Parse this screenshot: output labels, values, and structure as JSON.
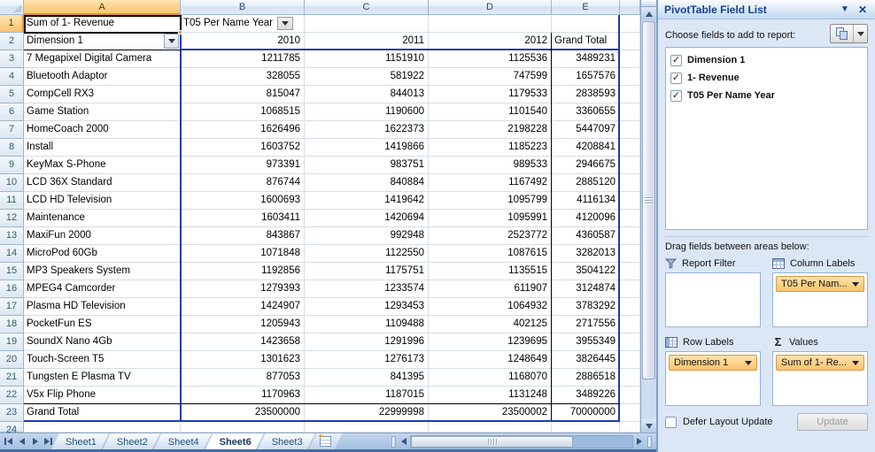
{
  "grid": {
    "column_headers": [
      "A",
      "B",
      "C",
      "D",
      "E"
    ],
    "selected_column": "A",
    "selected_row": 1,
    "cells": {
      "a1": "Sum of 1- Revenue",
      "b1": "T05 Per Name Year",
      "a2": "Dimension 1"
    },
    "year_headers": [
      "2010",
      "2011",
      "2012",
      "Grand Total"
    ],
    "products": [
      {
        "name": "7 Megapixel Digital Camera",
        "values": [
          1211785,
          1151910,
          1125536,
          3489231
        ]
      },
      {
        "name": "Bluetooth Adaptor",
        "values": [
          328055,
          581922,
          747599,
          1657576
        ]
      },
      {
        "name": "CompCell RX3",
        "values": [
          815047,
          844013,
          1179533,
          2838593
        ]
      },
      {
        "name": "Game Station",
        "values": [
          1068515,
          1190600,
          1101540,
          3360655
        ]
      },
      {
        "name": "HomeCoach 2000",
        "values": [
          1626496,
          1622373,
          2198228,
          5447097
        ]
      },
      {
        "name": "Install",
        "values": [
          1603752,
          1419866,
          1185223,
          4208841
        ]
      },
      {
        "name": "KeyMax S-Phone",
        "values": [
          973391,
          983751,
          989533,
          2946675
        ]
      },
      {
        "name": "LCD 36X Standard",
        "values": [
          876744,
          840884,
          1167492,
          2885120
        ]
      },
      {
        "name": "LCD HD Television",
        "values": [
          1600693,
          1419642,
          1095799,
          4116134
        ]
      },
      {
        "name": "Maintenance",
        "values": [
          1603411,
          1420694,
          1095991,
          4120096
        ]
      },
      {
        "name": "MaxiFun 2000",
        "values": [
          843867,
          992948,
          2523772,
          4360587
        ]
      },
      {
        "name": "MicroPod 60Gb",
        "values": [
          1071848,
          1122550,
          1087615,
          3282013
        ]
      },
      {
        "name": "MP3 Speakers System",
        "values": [
          1192856,
          1175751,
          1135515,
          3504122
        ]
      },
      {
        "name": "MPEG4 Camcorder",
        "values": [
          1279393,
          1233574,
          611907,
          3124874
        ]
      },
      {
        "name": "Plasma HD Television",
        "values": [
          1424907,
          1293453,
          1064932,
          3783292
        ]
      },
      {
        "name": "PocketFun ES",
        "values": [
          1205943,
          1109488,
          402125,
          2717556
        ]
      },
      {
        "name": "SoundX Nano 4Gb",
        "values": [
          1423658,
          1291996,
          1239695,
          3955349
        ]
      },
      {
        "name": "Touch-Screen T5",
        "values": [
          1301623,
          1276173,
          1248649,
          3826445
        ]
      },
      {
        "name": "Tungsten E Plasma TV",
        "values": [
          877053,
          841395,
          1168070,
          2886518
        ]
      },
      {
        "name": "V5x Flip Phone",
        "values": [
          1170963,
          1187015,
          1131248,
          3489226
        ]
      }
    ],
    "grand_total": {
      "name": "Grand Total",
      "values": [
        23500000,
        22999998,
        23500002,
        70000000
      ]
    }
  },
  "tabbar": {
    "tabs": [
      {
        "label": "Sheet1",
        "active": false
      },
      {
        "label": "Sheet2",
        "active": false
      },
      {
        "label": "Sheet4",
        "active": false
      },
      {
        "label": "Sheet6",
        "active": true
      },
      {
        "label": "Sheet3",
        "active": false
      }
    ]
  },
  "pane": {
    "title": "PivotTable Field List",
    "choose_label": "Choose fields to add to report:",
    "fields": [
      {
        "label": "Dimension 1",
        "checked": true
      },
      {
        "label": "1- Revenue",
        "checked": true
      },
      {
        "label": "T05 Per Name Year",
        "checked": true
      }
    ],
    "drag_label": "Drag fields between areas below:",
    "areas": {
      "report_filter": {
        "label": "Report Filter",
        "items": []
      },
      "column_labels": {
        "label": "Column Labels",
        "items": [
          "T05 Per Nam..."
        ]
      },
      "row_labels": {
        "label": "Row Labels",
        "items": [
          "Dimension 1"
        ]
      },
      "values": {
        "label": "Values",
        "items": [
          "Sum of 1- Re..."
        ]
      }
    },
    "defer_label": "Defer Layout Update",
    "update_label": "Update",
    "check_glyph": "✓"
  },
  "colors": {
    "pivot_border_blue": "#1f3bb3",
    "pivot_border_black": "#000000",
    "selected_header_orange": "#f8c671",
    "pill_orange": "#f9c46b",
    "pane_title_text": "#15428b"
  }
}
